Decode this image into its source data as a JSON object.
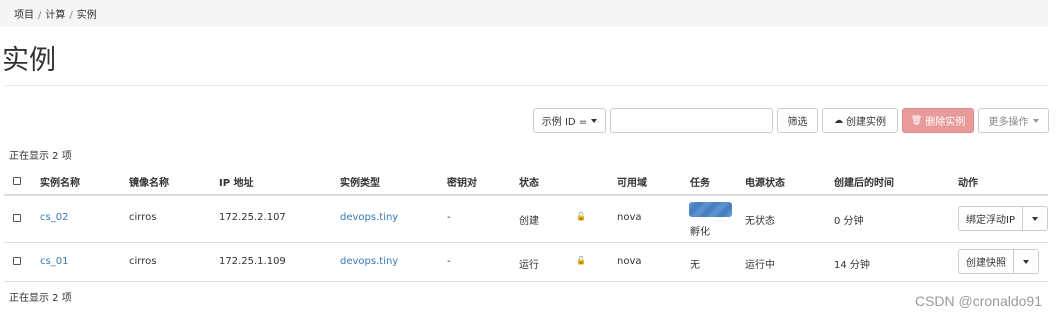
{
  "breadcrumb": {
    "items": [
      "项目",
      "计算",
      "实例"
    ],
    "separator": "/"
  },
  "page": {
    "title": "实例"
  },
  "toolbar": {
    "filter_select": "示例 ID =",
    "filter_placeholder": "",
    "filter_button": "筛选",
    "create_button": "创建实例",
    "delete_button": "删除实例",
    "more_button": "更多操作"
  },
  "count_text": "正在显示 2 项",
  "table": {
    "headers": {
      "name": "实例名称",
      "image": "镜像名称",
      "ip": "IP 地址",
      "flavor": "实例类型",
      "keypair": "密钥对",
      "status": "状态",
      "az": "可用域",
      "task": "任务",
      "power": "电源状态",
      "age": "创建后的时间",
      "actions": "动作"
    },
    "rows": [
      {
        "name": "cs_02",
        "image": "cirros",
        "ip": "172.25.2.107",
        "flavor": "devops.tiny",
        "keypair": "-",
        "status": "创建",
        "az": "nova",
        "task": "孵化",
        "power": "无状态",
        "age": "0 分钟",
        "action": "绑定浮动IP"
      },
      {
        "name": "cs_01",
        "image": "cirros",
        "ip": "172.25.1.109",
        "flavor": "devops.tiny",
        "keypair": "-",
        "status": "运行",
        "az": "nova",
        "task": "无",
        "power": "运行中",
        "age": "14 分钟",
        "action": "创建快照"
      }
    ]
  },
  "watermark": "CSDN @cronaldo91",
  "colors": {
    "link": "#337ab7",
    "danger_button": "#e99a9a",
    "progress": "#4a7fc1"
  }
}
